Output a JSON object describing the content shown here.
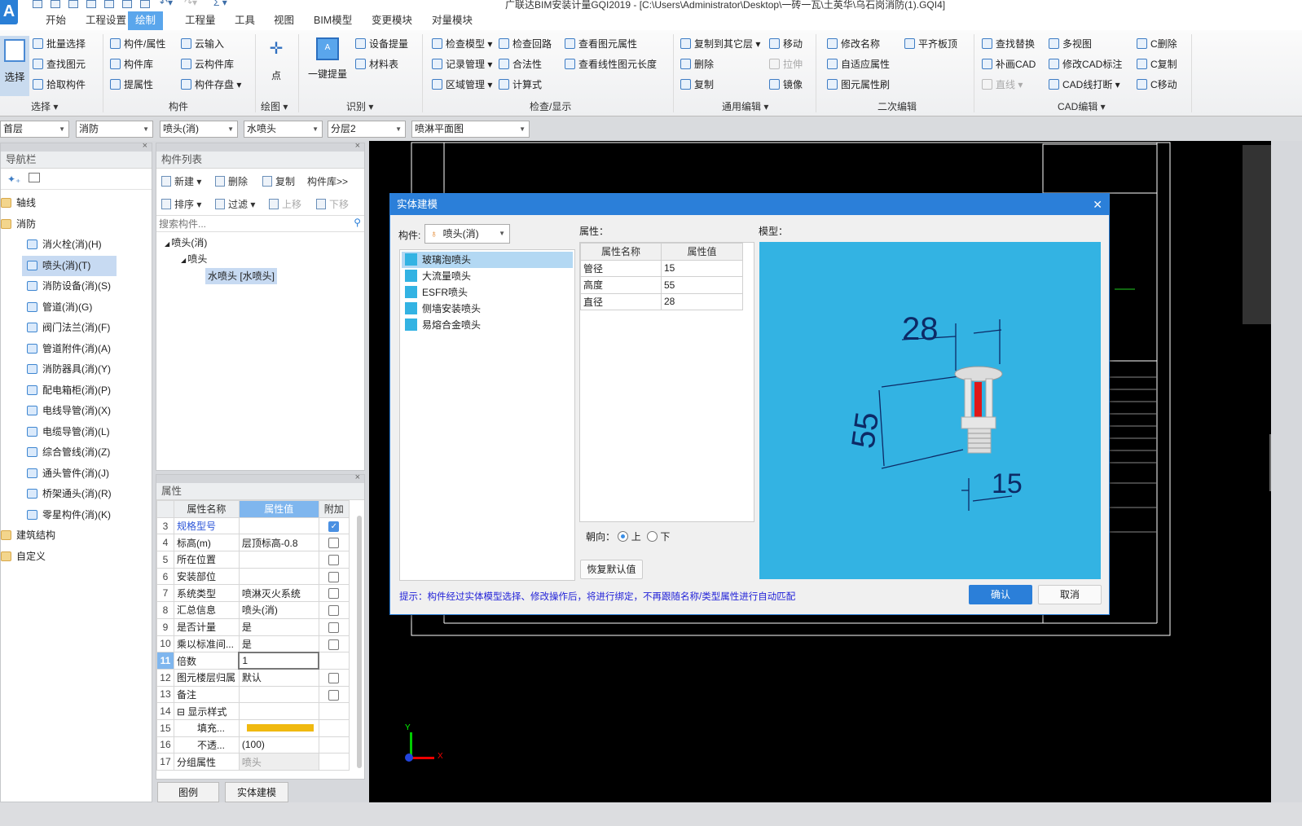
{
  "app": {
    "logo": "A",
    "title": "广联达BIM安装计量GQI2019 - [C:\\Users\\Administrator\\Desktop\\一砖一瓦\\土英华\\乌石岗消防(1).GQI4]"
  },
  "tabs": [
    "开始",
    "工程设置",
    "绘制",
    "工程量",
    "工具",
    "视图",
    "BIM模型",
    "变更模块",
    "对量模块"
  ],
  "active_tab": "绘制",
  "ribbon": {
    "select_big": "选择",
    "point_big": "点",
    "one_key_big": "一键提量",
    "items": [
      "批量选择",
      "查找图元",
      "拾取构件",
      "构件/属性",
      "构件库",
      "提属性",
      "云输入",
      "云构件库",
      "构件存盘 ▾",
      "设备提量",
      "材料表",
      "检查模型 ▾",
      "记录管理 ▾",
      "区域管理 ▾",
      "检查回路",
      "合法性",
      "计算式",
      "查看图元属性",
      "查看线性图元长度",
      "复制到其它层 ▾",
      "删除",
      "复制",
      "移动",
      "拉伸",
      "镜像",
      "修改名称",
      "自适应属性",
      "图元属性刷",
      "平齐板顶",
      "查找替换",
      "补画CAD",
      "直线 ▾",
      "多视图",
      "修改CAD标注",
      "CAD线打断 ▾",
      "C删除",
      "C复制",
      "C移动"
    ],
    "disabled": [
      "拉伸",
      "直线 ▾"
    ],
    "groups": [
      "选择 ▾",
      "构件",
      "绘图 ▾",
      "识别 ▾",
      "检查/显示",
      "通用编辑 ▾",
      "二次编辑",
      "CAD编辑 ▾"
    ]
  },
  "filters": [
    "首层",
    "消防",
    "喷头(消)",
    "水喷头",
    "分层2",
    "喷淋平面图"
  ],
  "nav": {
    "title": "导航栏",
    "items": [
      {
        "label": "轴线",
        "type": "folder"
      },
      {
        "label": "消防",
        "type": "folder"
      },
      {
        "label": "消火栓(消)(H)",
        "type": "child"
      },
      {
        "label": "喷头(消)(T)",
        "type": "child",
        "selected": true
      },
      {
        "label": "消防设备(消)(S)",
        "type": "child"
      },
      {
        "label": "管道(消)(G)",
        "type": "child"
      },
      {
        "label": "阀门法兰(消)(F)",
        "type": "child"
      },
      {
        "label": "管道附件(消)(A)",
        "type": "child"
      },
      {
        "label": "消防器具(消)(Y)",
        "type": "child"
      },
      {
        "label": "配电箱柜(消)(P)",
        "type": "child"
      },
      {
        "label": "电线导管(消)(X)",
        "type": "child"
      },
      {
        "label": "电缆导管(消)(L)",
        "type": "child"
      },
      {
        "label": "综合管线(消)(Z)",
        "type": "child"
      },
      {
        "label": "通头管件(消)(J)",
        "type": "child"
      },
      {
        "label": "桥架通头(消)(R)",
        "type": "child"
      },
      {
        "label": "零星构件(消)(K)",
        "type": "child"
      },
      {
        "label": "建筑结构",
        "type": "folder"
      },
      {
        "label": "自定义",
        "type": "folder"
      }
    ]
  },
  "component_list": {
    "title": "构件列表",
    "toolbar": [
      "新建 ▾",
      "删除",
      "复制",
      "构件库>>",
      "排序 ▾",
      "过滤 ▾",
      "上移",
      "下移"
    ],
    "search_placeholder": "搜索构件...",
    "tree": [
      "喷头(消)",
      "喷头",
      "水喷头 [水喷头]"
    ]
  },
  "properties": {
    "title": "属性",
    "headers": [
      "属性名称",
      "属性值",
      "附加"
    ],
    "rows": [
      {
        "n": "3",
        "name": "规格型号",
        "value": "",
        "check": true
      },
      {
        "n": "4",
        "name": "标高(m)",
        "value": "层顶标高-0.8",
        "check": false
      },
      {
        "n": "5",
        "name": "所在位置",
        "value": "",
        "check": false
      },
      {
        "n": "6",
        "name": "安装部位",
        "value": "",
        "check": false
      },
      {
        "n": "7",
        "name": "系统类型",
        "value": "喷淋灭火系统",
        "check": false
      },
      {
        "n": "8",
        "name": "汇总信息",
        "value": "喷头(消)",
        "check": false
      },
      {
        "n": "9",
        "name": "是否计量",
        "value": "是",
        "check": false
      },
      {
        "n": "10",
        "name": "乘以标准间...",
        "value": "是",
        "check": false
      },
      {
        "n": "11",
        "name": "倍数",
        "value": "1"
      },
      {
        "n": "12",
        "name": "图元楼层归属",
        "value": "默认",
        "check": false
      },
      {
        "n": "13",
        "name": "备注",
        "value": "",
        "check": false
      },
      {
        "n": "14",
        "name": "⊟ 显示样式",
        "value": ""
      },
      {
        "n": "15",
        "name": "填充...",
        "value": ""
      },
      {
        "n": "16",
        "name": "不透...",
        "value": "(100)"
      },
      {
        "n": "17",
        "name": "分组属性",
        "value": "喷头"
      }
    ],
    "fill_color": "#f0b90f",
    "bottom_tabs": [
      "图例",
      "实体建模"
    ]
  },
  "dialog": {
    "title": "实体建模",
    "component_label": "构件:",
    "component_value": "喷头(消)",
    "models": [
      "玻璃泡喷头",
      "大流量喷头",
      "ESFR喷头",
      "侧墙安装喷头",
      "易熔合金喷头"
    ],
    "selected_model": "玻璃泡喷头",
    "props_label": "属性：",
    "props_headers": [
      "属性名称",
      "属性值"
    ],
    "props": [
      {
        "name": "管径",
        "value": "15"
      },
      {
        "name": "高度",
        "value": "55"
      },
      {
        "name": "直径",
        "value": "28"
      }
    ],
    "model_label": "模型：",
    "dims": {
      "diameter": "28",
      "height": "55",
      "pipe": "15"
    },
    "direction_label": "朝向：",
    "direction_options": [
      "上",
      "下"
    ],
    "direction_selected": "上",
    "reset_label": "恢复默认值",
    "hint": "提示：构件经过实体模型选择、修改操作后，将进行绑定，不再跟随名称/类型属性进行自动匹配",
    "ok_label": "确认",
    "cancel_label": "取消",
    "model_bg": "#33b3e3"
  },
  "canvas": {
    "axis_x": "X",
    "axis_y": "Y"
  }
}
